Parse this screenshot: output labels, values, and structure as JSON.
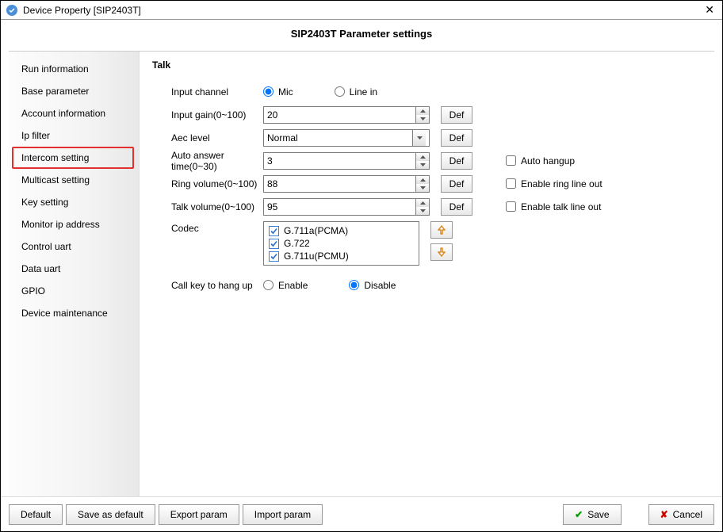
{
  "window": {
    "title": "Device Property [SIP2403T]"
  },
  "header": {
    "title": "SIP2403T Parameter settings"
  },
  "sidebar": {
    "items": [
      {
        "label": "Run information"
      },
      {
        "label": "Base parameter"
      },
      {
        "label": "Account information"
      },
      {
        "label": "Ip filter"
      },
      {
        "label": "Intercom setting"
      },
      {
        "label": "Multicast setting"
      },
      {
        "label": "Key setting"
      },
      {
        "label": "Monitor ip address"
      },
      {
        "label": "Control uart"
      },
      {
        "label": "Data uart"
      },
      {
        "label": "GPIO"
      },
      {
        "label": "Device maintenance"
      }
    ],
    "selected_index": 4
  },
  "talk": {
    "section_title": "Talk",
    "labels": {
      "input_channel": "Input channel",
      "input_gain": "Input gain(0~100)",
      "aec_level": "Aec level",
      "auto_answer": "Auto answer time(0~30)",
      "ring_volume": "Ring volume(0~100)",
      "talk_volume": "Talk volume(0~100)",
      "codec": "Codec",
      "call_key": "Call key to hang up"
    },
    "input_channel": {
      "mic": "Mic",
      "line_in": "Line in",
      "selected": "mic"
    },
    "input_gain_value": "20",
    "aec_level_value": "Normal",
    "auto_answer_value": "3",
    "ring_volume_value": "88",
    "talk_volume_value": "95",
    "def_button": "Def",
    "checkboxes": {
      "auto_hangup": "Auto hangup",
      "enable_ring": "Enable ring line out",
      "enable_talk": "Enable talk line out"
    },
    "codecs": [
      {
        "label": "G.711a(PCMA)",
        "checked": true
      },
      {
        "label": "G.722",
        "checked": true
      },
      {
        "label": "G.711u(PCMU)",
        "checked": true
      }
    ],
    "call_key_hangup": {
      "enable": "Enable",
      "disable": "Disable",
      "selected": "disable"
    }
  },
  "buttons": {
    "default": "Default",
    "save_as_default": "Save as default",
    "export_param": "Export param",
    "import_param": "Import param",
    "save": "Save",
    "cancel": "Cancel"
  }
}
